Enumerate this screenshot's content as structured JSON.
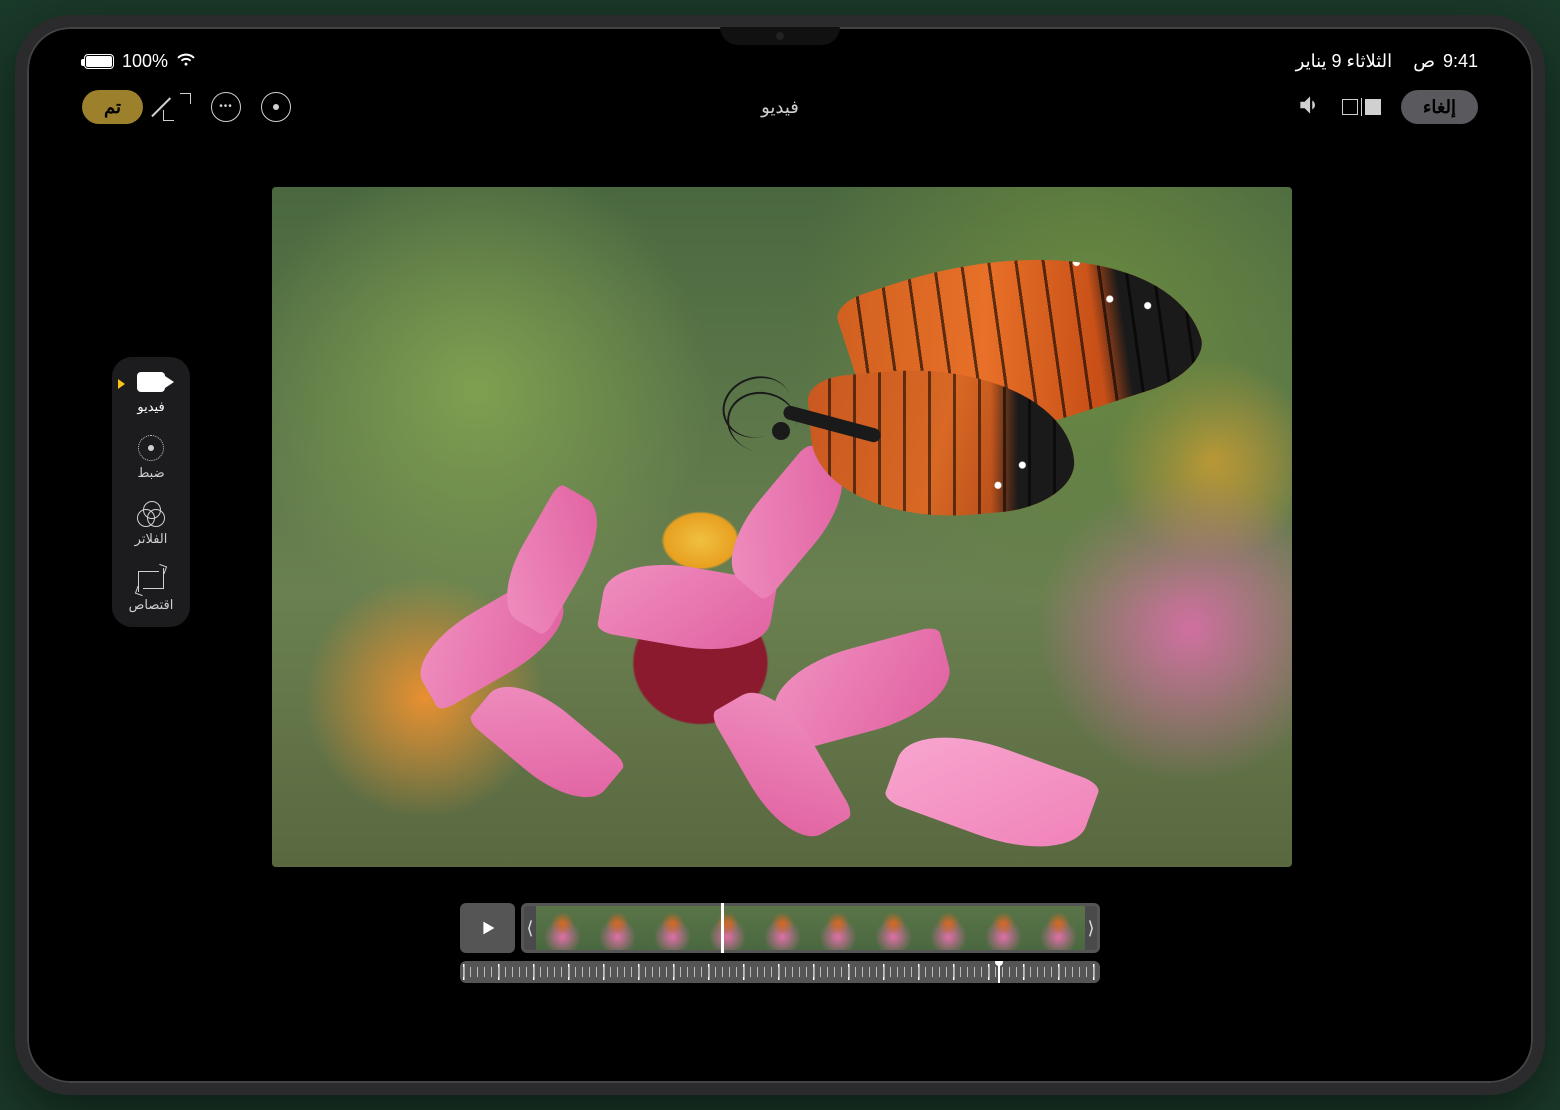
{
  "status": {
    "time": "9:41",
    "period": "ص",
    "date": "الثلاثاء 9 يناير",
    "battery_pct": "100%"
  },
  "topbar": {
    "cancel": "إلغاء",
    "title": "فيديو",
    "done": "تم"
  },
  "tools": {
    "video": "فيديو",
    "adjust": "ضبط",
    "filters": "الفلاتر",
    "crop": "اقتصاص"
  },
  "icons": {
    "more": "•••",
    "trim_left": "⟨",
    "trim_right": "⟩"
  }
}
